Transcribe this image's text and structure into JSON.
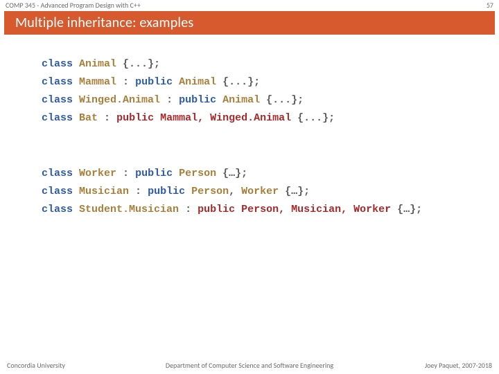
{
  "header": {
    "course": "COMP 345 - Advanced Program Design with C++",
    "page_number": "57"
  },
  "title": "Multiple inheritance: examples",
  "kw_class": "class",
  "kw_public": "public",
  "group1": {
    "l1_type": "Animal",
    "l2_type": "Mammal",
    "l2_base": "Animal",
    "l3_type": "Winged.Animal",
    "l3_base": "Animal",
    "l4_type": "Bat",
    "l4_pub": "public ",
    "l4_b1": "Mammal",
    "l4_comma": ", ",
    "l4_b2": "Winged.Animal"
  },
  "group2": {
    "l1_type": "Worker",
    "l1_base": "Person",
    "l2_type": "Musician",
    "l2_b1": "Person",
    "l2_b2": "Worker",
    "l3_type": "Student.Musician",
    "l3_pub": "public ",
    "l3_b1": "Person",
    "l3_c1": ", ",
    "l3_b2": "Musician",
    "l3_c2": ", ",
    "l3_b3": "Worker"
  },
  "punct": {
    "brace_dots": " {...};",
    "brace_ellip": " {…};",
    "colon": " : "
  },
  "footer": {
    "left": "Concordia University",
    "center": "Department of Computer Science and Software Engineering",
    "right": "Joey Paquet, 2007-2018"
  }
}
